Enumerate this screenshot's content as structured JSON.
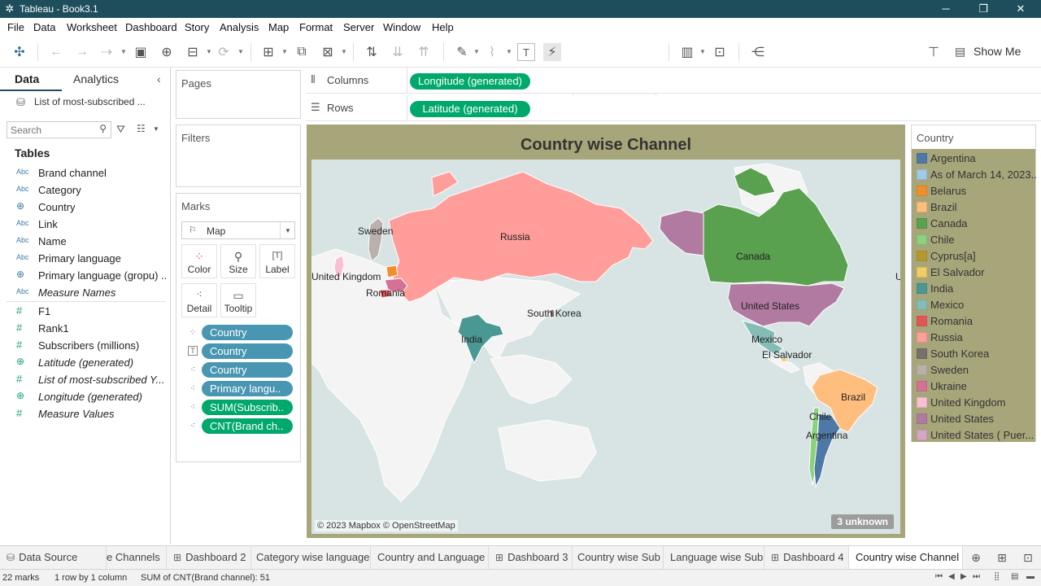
{
  "window": {
    "title": "Tableau - Book3.1",
    "minimize": "─",
    "restore": "❐",
    "close": "✕"
  },
  "menu": [
    "File",
    "Data",
    "Worksheet",
    "Dashboard",
    "Story",
    "Analysis",
    "Map",
    "Format",
    "Server",
    "Window",
    "Help"
  ],
  "toolbar": {
    "show_me": "Show Me"
  },
  "data_pane": {
    "tab_data": "Data",
    "tab_analytics": "Analytics",
    "datasource": "List of most-subscribed ...",
    "search_placeholder": "Search",
    "tables_heading": "Tables",
    "fields": [
      {
        "type": "Abc",
        "name": "Brand channel"
      },
      {
        "type": "Abc",
        "name": "Category"
      },
      {
        "type": "⊕",
        "name": "Country"
      },
      {
        "type": "Abc",
        "name": "Link"
      },
      {
        "type": "Abc",
        "name": "Name"
      },
      {
        "type": "Abc",
        "name": "Primary language"
      },
      {
        "type": "⊕",
        "name": "Primary language (gropu) ..."
      },
      {
        "type": "Abc",
        "name": "Measure Names"
      },
      {
        "type": "#",
        "name": "F1"
      },
      {
        "type": "#",
        "name": "Rank1"
      },
      {
        "type": "#",
        "name": "Subscribers (millions)"
      },
      {
        "type": "⊕",
        "name": "Latitude (generated)"
      },
      {
        "type": "#",
        "name": "List of most-subscribed Y..."
      },
      {
        "type": "⊕",
        "name": "Longitude (generated)"
      },
      {
        "type": "#",
        "name": "Measure Values"
      }
    ]
  },
  "cards": {
    "pages": "Pages",
    "filters": "Filters",
    "marks": "Marks",
    "mark_type": "Map",
    "buttons": {
      "color": "Color",
      "size": "Size",
      "label": "Label",
      "detail": "Detail",
      "tooltip": "Tooltip"
    },
    "pills": [
      {
        "label": "Country"
      },
      {
        "label": "Country"
      },
      {
        "label": "Country"
      },
      {
        "label": "Primary langu.."
      },
      {
        "label": "SUM(Subscrib.."
      },
      {
        "label": "CNT(Brand ch.."
      }
    ]
  },
  "shelves": {
    "columns_label": "Columns",
    "columns_pill": "Longitude (generated)",
    "rows_label": "Rows",
    "rows_pill": "Latitude (generated)"
  },
  "viz": {
    "title": "Country wise Channel",
    "attribution": "© 2023 Mapbox © OpenStreetMap",
    "unknown": "3 unknown",
    "map_labels": {
      "sweden": "Sweden",
      "russia": "Russia",
      "uk": "United Kingdom",
      "romania": "Romania",
      "south_korea": "South Korea",
      "india": "India",
      "canada": "Canada",
      "united_states": "United States",
      "mexico": "Mexico",
      "el_salvador": "El Salvador",
      "brazil": "Brazil",
      "chile": "Chile",
      "argentina": "Argentina",
      "edge_u": "U"
    }
  },
  "legend": {
    "title": "Country",
    "items": [
      {
        "name": "Argentina",
        "color": "#4e79a7"
      },
      {
        "name": "As of March 14, 2023...",
        "color": "#a0cbe8"
      },
      {
        "name": "Belarus",
        "color": "#f28e2b"
      },
      {
        "name": "Brazil",
        "color": "#ffbe7d"
      },
      {
        "name": "Canada",
        "color": "#59a14f"
      },
      {
        "name": "Chile",
        "color": "#8cd17d"
      },
      {
        "name": "Cyprus[a]",
        "color": "#b6992d"
      },
      {
        "name": "El Salvador",
        "color": "#f1ce63"
      },
      {
        "name": "India",
        "color": "#499894"
      },
      {
        "name": "Mexico",
        "color": "#86bcb6"
      },
      {
        "name": "Romania",
        "color": "#e15759"
      },
      {
        "name": "Russia",
        "color": "#ff9d9a"
      },
      {
        "name": "South Korea",
        "color": "#79706e"
      },
      {
        "name": "Sweden",
        "color": "#bab0ac"
      },
      {
        "name": "Ukraine",
        "color": "#d37295"
      },
      {
        "name": "United Kingdom",
        "color": "#fabfd2"
      },
      {
        "name": "United States",
        "color": "#b07aa1"
      },
      {
        "name": "United States ( Puer...",
        "color": "#d4a6c8"
      }
    ]
  },
  "sheet_tabs": [
    {
      "label": "Data Source",
      "icon": "⛁"
    },
    {
      "label": "e Channels",
      "icon": ""
    },
    {
      "label": "Dashboard 2",
      "icon": "⊞"
    },
    {
      "label": "Category wise language",
      "icon": ""
    },
    {
      "label": "Country and Language",
      "icon": ""
    },
    {
      "label": "Dashboard 3",
      "icon": "⊞"
    },
    {
      "label": "Country wise Sub",
      "icon": ""
    },
    {
      "label": "Language wise Sub",
      "icon": ""
    },
    {
      "label": "Dashboard 4",
      "icon": "⊞"
    },
    {
      "label": "Country wise Channel",
      "icon": ""
    }
  ],
  "status": {
    "marks": "22 marks",
    "rows": "1 row by 1 column",
    "sum": "SUM of CNT(Brand channel): 51"
  }
}
